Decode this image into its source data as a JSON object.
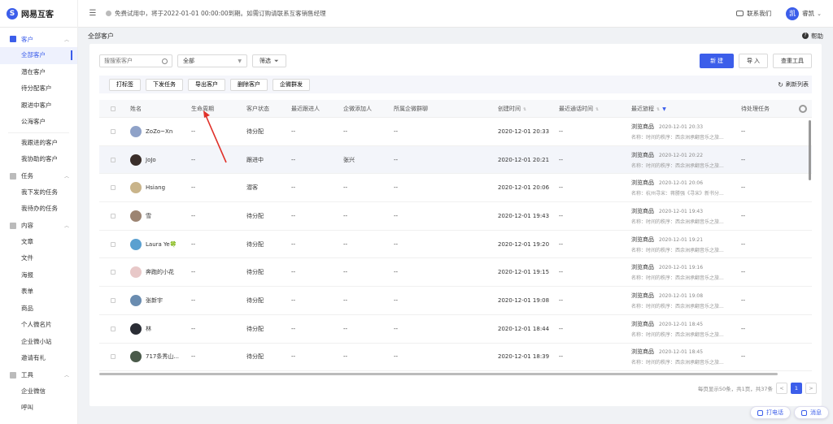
{
  "app": {
    "name": "网易互客"
  },
  "topbar": {
    "notice": "免费试用中，将于2022-01-01 00:00:00到期。如需订购请联系互客销售经理",
    "contact": "联系我们",
    "user_initial": "凯",
    "user_name": "睿凯"
  },
  "sidebar": {
    "groups": [
      {
        "label": "客户",
        "items": [
          "全部客户",
          "潜在客户",
          "待分配客户",
          "跟进中客户",
          "公海客户"
        ],
        "extra": [
          "我跟进的客户",
          "我协助的客户"
        ]
      },
      {
        "label": "任务",
        "items": [
          "我下发的任务",
          "我待办的任务"
        ]
      },
      {
        "label": "内容",
        "items": [
          "文章",
          "文件",
          "海报",
          "表单",
          "商品",
          "个人微名片",
          "企业微小站",
          "邀请有礼"
        ]
      },
      {
        "label": "工具",
        "items": [
          "企业微信",
          "呼叫"
        ]
      }
    ]
  },
  "page": {
    "title": "全部客户",
    "help": "帮助"
  },
  "filters": {
    "search_placeholder": "搜搜索客户",
    "scope": "全部",
    "filter_label": "筛选"
  },
  "buttons": {
    "new": "新 建",
    "import": "导 入",
    "column_tool": "查重工具"
  },
  "bulk": {
    "actions": [
      "打标签",
      "下发任务",
      "导出客户",
      "删除客户",
      "企微群发"
    ],
    "refresh": "刷新列表"
  },
  "columns": [
    "姓名",
    "生命周期",
    "客户状态",
    "最近跟进人",
    "企微添加人",
    "所属企微群聊",
    "创建时间",
    "最近通话时间",
    "最近旅程",
    "待处理任务"
  ],
  "rows": [
    {
      "name": "ZoZo~Xn",
      "life": "--",
      "status": "待分配",
      "follow": "--",
      "wadd": "--",
      "group": "--",
      "created": "2020-12-01 20:33",
      "comm": "--",
      "track": "浏览商品",
      "track_time": "2020-12-01 20:33",
      "track_sub": "名称：时间的秩序：西余洲承翻音乐之旅...",
      "pending": "--",
      "avatar": "#8fa2c8"
    },
    {
      "name": "JoJo",
      "life": "--",
      "status": "跟进中",
      "follow": "--",
      "wadd": "张兴",
      "group": "--",
      "created": "2020-12-01 20:21",
      "comm": "--",
      "track": "浏览商品",
      "track_time": "2020-12-01 20:22",
      "track_sub": "名称：时间的秩序：西余洲承翻音乐之旅...",
      "pending": "--",
      "avatar": "#3a2e2a"
    },
    {
      "name": "Hsiang",
      "life": "--",
      "status": "潜客",
      "follow": "--",
      "wadd": "--",
      "group": "--",
      "created": "2020-12-01 20:06",
      "comm": "--",
      "track": "浏览商品",
      "track_time": "2020-12-01 20:06",
      "track_sub": "名称：杭州寻宋：蒋勝强《寻宋》新书分...",
      "pending": "--",
      "avatar": "#c9b48a"
    },
    {
      "name": "雪",
      "life": "--",
      "status": "待分配",
      "follow": "--",
      "wadd": "--",
      "group": "--",
      "created": "2020-12-01 19:43",
      "comm": "--",
      "track": "浏览商品",
      "track_time": "2020-12-01 19:43",
      "track_sub": "名称：时间的秩序：西余洲承翻音乐之旅...",
      "pending": "--",
      "avatar": "#9c8472"
    },
    {
      "name": "Laura Ye🍀",
      "life": "--",
      "status": "待分配",
      "follow": "--",
      "wadd": "--",
      "group": "--",
      "created": "2020-12-01 19:20",
      "comm": "--",
      "track": "浏览商品",
      "track_time": "2020-12-01 19:21",
      "track_sub": "名称：时间的秩序：西余洲承翻音乐之旅...",
      "pending": "--",
      "avatar": "#5aa0d0"
    },
    {
      "name": "奔跑的小花",
      "life": "--",
      "status": "待分配",
      "follow": "--",
      "wadd": "--",
      "group": "--",
      "created": "2020-12-01 19:15",
      "comm": "--",
      "track": "浏览商品",
      "track_time": "2020-12-01 19:16",
      "track_sub": "名称：时间的秩序：西余洲承翻音乐之旅...",
      "pending": "--",
      "avatar": "#e8c8c8"
    },
    {
      "name": "张新宇",
      "life": "--",
      "status": "待分配",
      "follow": "--",
      "wadd": "--",
      "group": "--",
      "created": "2020-12-01 19:08",
      "comm": "--",
      "track": "浏览商品",
      "track_time": "2020-12-01 19:08",
      "track_sub": "名称：时间的秩序：西余洲承翻音乐之旅...",
      "pending": "--",
      "avatar": "#6a8cb0"
    },
    {
      "name": "林",
      "life": "--",
      "status": "待分配",
      "follow": "--",
      "wadd": "--",
      "group": "--",
      "created": "2020-12-01 18:44",
      "comm": "--",
      "track": "浏览商品",
      "track_time": "2020-12-01 18:45",
      "track_sub": "名称：时间的秩序：西余洲承翻音乐之旅...",
      "pending": "--",
      "avatar": "#2a2d35"
    },
    {
      "name": "717条秀山...",
      "life": "--",
      "status": "待分配",
      "follow": "--",
      "wadd": "--",
      "group": "--",
      "created": "2020-12-01 18:39",
      "comm": "--",
      "track": "浏览商品",
      "track_time": "2020-12-01 18:45",
      "track_sub": "名称：时间的秩序：西余洲承翻音乐之旅...",
      "pending": "--",
      "avatar": "#4a5a4a"
    }
  ],
  "pager": {
    "summary": "每页显示50条，共1页，共37条",
    "current": "1",
    "prev": "<",
    "next": ">"
  },
  "float": {
    "call": "打电话",
    "message": "消息"
  },
  "colors": {
    "accent": "#3c5eea",
    "arrow": "#e0312a"
  }
}
